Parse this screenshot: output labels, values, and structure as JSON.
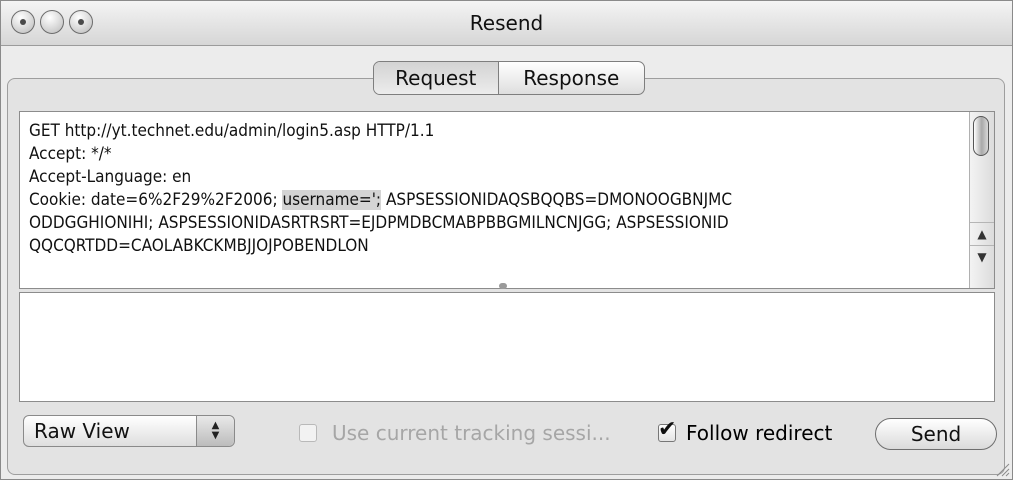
{
  "window": {
    "title": "Resend",
    "controls": [
      "close",
      "minimize",
      "zoom"
    ]
  },
  "tabs": [
    {
      "label": "Request",
      "selected": true
    },
    {
      "label": "Response",
      "selected": false
    }
  ],
  "request": {
    "lines": [
      [
        "GET http://yt.technet.edu/admin/login5.asp HTTP/1.1"
      ],
      [
        "Accept: */*"
      ],
      [
        "Accept-Language: en"
      ],
      [
        "Cookie: date=6%2F29%2F2006; ",
        "username=';",
        " ASPSESSIONIDAQSBQQBS=DMONOOGBNJMC"
      ],
      [
        "ODDGGHIONIHI; ASPSESSIONIDASRTRSRT=EJDPMDBCMABPBBGMILNCNJGG; ASPSESSIONID"
      ],
      [
        "QQCQRTDD=CAOLABKCKMBJJOJPOBENDLON"
      ]
    ],
    "highlighted_text": "username=';"
  },
  "response_text": "",
  "view_mode": {
    "selected": "Raw View"
  },
  "tracking_checkbox": {
    "label": "Use current tracking sessi...",
    "checked": false,
    "enabled": false
  },
  "redirect_checkbox": {
    "label": "Follow redirect",
    "checked": true,
    "enabled": true
  },
  "send_button": "Send",
  "icons": {
    "scroll_up": "▲",
    "scroll_down": "▼",
    "stepper": "▲▼",
    "checkmark": "✔"
  }
}
